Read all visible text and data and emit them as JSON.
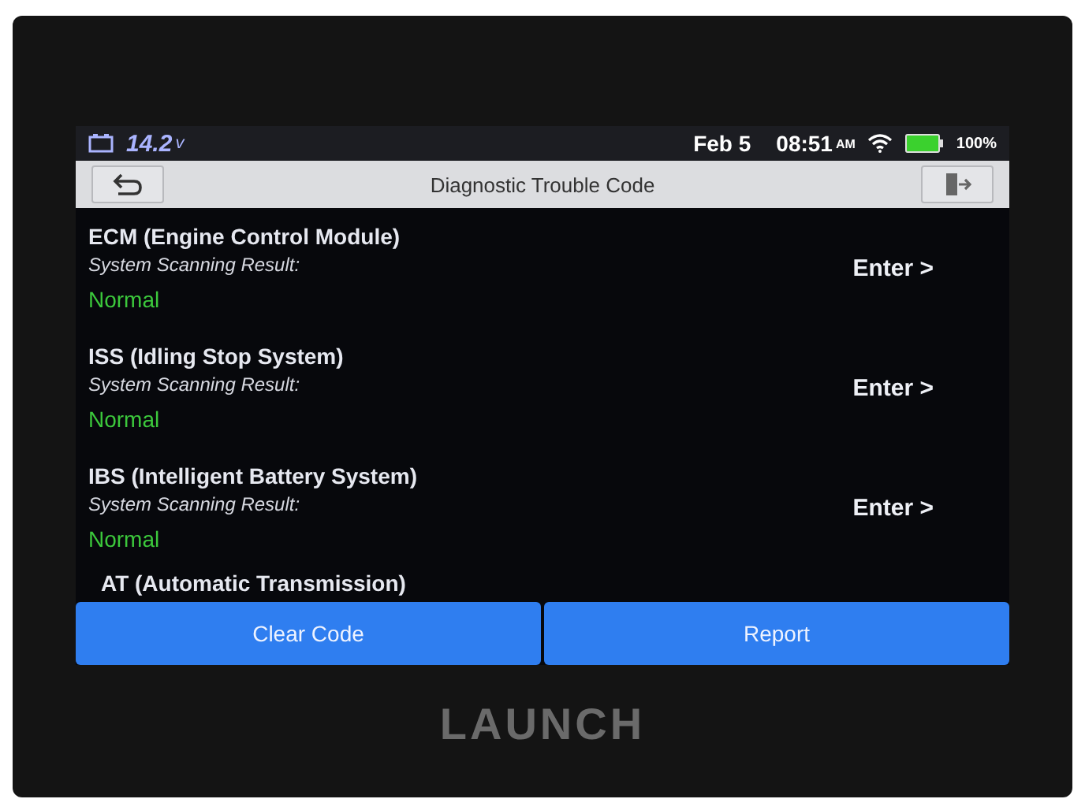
{
  "status_bar": {
    "voltage": "14.2",
    "voltage_unit": "v",
    "date": "Feb 5",
    "time": "08:51",
    "meridiem": "AM",
    "battery": "100%"
  },
  "title_bar": {
    "title": "Diagnostic Trouble Code"
  },
  "systems": [
    {
      "name": "ECM (Engine Control Module)",
      "result_label": "System Scanning Result:",
      "result": "Normal",
      "action": "Enter >"
    },
    {
      "name": "ISS (Idling Stop System)",
      "result_label": "System Scanning Result:",
      "result": "Normal",
      "action": "Enter >"
    },
    {
      "name": "IBS (Intelligent Battery System)",
      "result_label": "System Scanning Result:",
      "result": "Normal",
      "action": "Enter >"
    },
    {
      "name": "AT (Automatic Transmission)"
    }
  ],
  "buttons": [
    "Clear Code",
    "Report"
  ],
  "device_brand": "LAUNCH"
}
